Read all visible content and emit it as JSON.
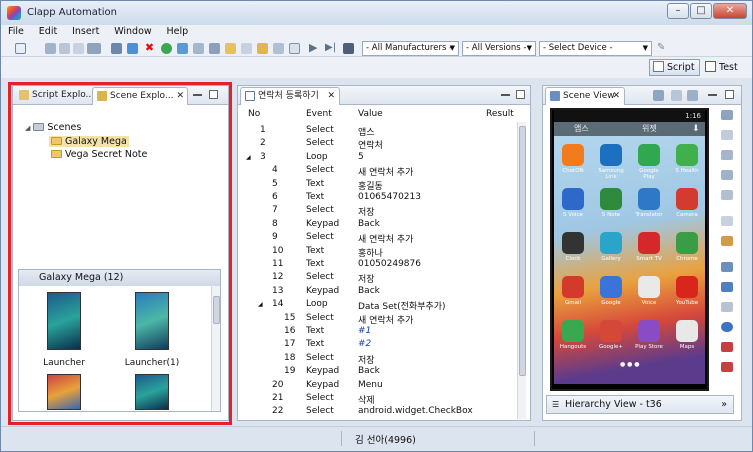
{
  "window": {
    "title": "Clapp Automation",
    "min": "–",
    "max": "□",
    "close": "✕"
  },
  "menu": [
    "File",
    "Edit",
    "Insert",
    "Window",
    "Help"
  ],
  "toolbar": {
    "manufacturers": "- All Manufacturers -",
    "versions": "- All Versions -",
    "device": "- Select Device -"
  },
  "perspectives": {
    "script": "Script",
    "test": "Test"
  },
  "left_panel": {
    "tabs": [
      "Script Explo...",
      "Scene Explo..."
    ],
    "tree": {
      "root": "Scenes",
      "children": [
        "Galaxy Mega",
        "Vega Secret Note"
      ]
    },
    "gallery": {
      "header": "Galaxy Mega (12)",
      "captions": [
        "Launcher",
        "Launcher(1)"
      ]
    }
  },
  "script_panel": {
    "tab": "연락처 등록하기",
    "columns": [
      "No",
      "Event",
      "Value",
      "Result"
    ],
    "rows": [
      {
        "no": "1",
        "event": "Select",
        "value": "앱스",
        "indent": 0
      },
      {
        "no": "2",
        "event": "Select",
        "value": "연락처",
        "indent": 0
      },
      {
        "no": "3",
        "event": "Loop",
        "value": "5",
        "indent": 0,
        "expand": "◢"
      },
      {
        "no": "4",
        "event": "Select",
        "value": "새 연락처 추가",
        "indent": 1
      },
      {
        "no": "5",
        "event": "Text",
        "value": "홍길동",
        "indent": 1
      },
      {
        "no": "6",
        "event": "Text",
        "value": "01065470213",
        "indent": 1
      },
      {
        "no": "7",
        "event": "Select",
        "value": "저장",
        "indent": 1
      },
      {
        "no": "8",
        "event": "Keypad",
        "value": "Back",
        "indent": 1
      },
      {
        "no": "9",
        "event": "Select",
        "value": "새 연락처 추가",
        "indent": 1
      },
      {
        "no": "10",
        "event": "Text",
        "value": "홍하나",
        "indent": 1
      },
      {
        "no": "11",
        "event": "Text",
        "value": "01050249876",
        "indent": 1
      },
      {
        "no": "12",
        "event": "Select",
        "value": "저장",
        "indent": 1
      },
      {
        "no": "13",
        "event": "Keypad",
        "value": "Back",
        "indent": 1
      },
      {
        "no": "14",
        "event": "Loop",
        "value": "Data Set(전화부추가)",
        "indent": 1,
        "expand": "◢"
      },
      {
        "no": "15",
        "event": "Select",
        "value": "새 연락처 추가",
        "indent": 2
      },
      {
        "no": "16",
        "event": "Text",
        "value": "#1",
        "indent": 2,
        "variable": true
      },
      {
        "no": "17",
        "event": "Text",
        "value": "#2",
        "indent": 2,
        "variable": true
      },
      {
        "no": "18",
        "event": "Select",
        "value": "저장",
        "indent": 2
      },
      {
        "no": "19",
        "event": "Keypad",
        "value": "Back",
        "indent": 2
      },
      {
        "no": "20",
        "event": "Keypad",
        "value": "Menu",
        "indent": 1
      },
      {
        "no": "21",
        "event": "Select",
        "value": "삭제",
        "indent": 1
      },
      {
        "no": "22",
        "event": "Select",
        "value": "android.widget.CheckBox",
        "indent": 1
      }
    ]
  },
  "scene_view": {
    "tab": "Scene View",
    "status_time": "1:16",
    "screen_tabs": [
      "앱스",
      "위젯"
    ],
    "apps": [
      {
        "label": "ChatON",
        "color": "#f27b1e"
      },
      {
        "label": "Samsung Link",
        "color": "#1d6fbf"
      },
      {
        "label": "Google Play",
        "color": "#2fa84f"
      },
      {
        "label": "S Health",
        "color": "#3fb04c"
      },
      {
        "label": "S Voice",
        "color": "#2c69c9"
      },
      {
        "label": "S Note",
        "color": "#2e8b3d"
      },
      {
        "label": "Translator",
        "color": "#2f78c8"
      },
      {
        "label": "Camera",
        "color": "#d33b2f"
      },
      {
        "label": "Clock",
        "color": "#333333"
      },
      {
        "label": "Gallery",
        "color": "#2aa4c9"
      },
      {
        "label": "Smart TV",
        "color": "#d6282a"
      },
      {
        "label": "Chrome",
        "color": "#3a9d45"
      },
      {
        "label": "Gmail",
        "color": "#d43a2c"
      },
      {
        "label": "Google",
        "color": "#3a74d8"
      },
      {
        "label": "Voice",
        "color": "#e9e9e9"
      },
      {
        "label": "YouTube",
        "color": "#d9261c"
      },
      {
        "label": "Hangouts",
        "color": "#3aa84f"
      },
      {
        "label": "Google+",
        "color": "#d34836"
      },
      {
        "label": "Play Store",
        "color": "#8a4cc2"
      },
      {
        "label": "Maps",
        "color": "#e8e8e8"
      }
    ],
    "hierarchy": "Hierarchy View - t36"
  },
  "status": {
    "user": "김 선아(4996)"
  }
}
